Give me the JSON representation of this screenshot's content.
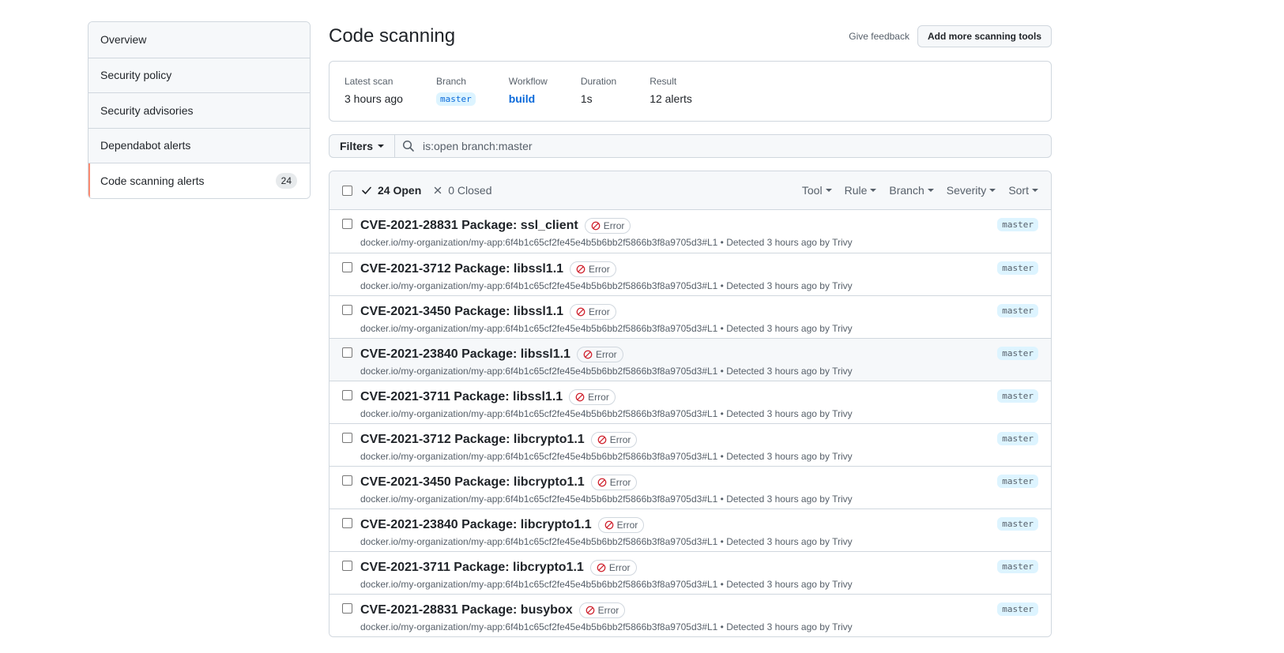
{
  "sidebar": {
    "items": [
      {
        "label": "Overview"
      },
      {
        "label": "Security policy"
      },
      {
        "label": "Security advisories"
      },
      {
        "label": "Dependabot alerts"
      },
      {
        "label": "Code scanning alerts",
        "count": "24",
        "active": true
      }
    ]
  },
  "header": {
    "title": "Code scanning",
    "feedback_label": "Give feedback",
    "add_tools_label": "Add more scanning tools"
  },
  "scan": {
    "latest_label": "Latest scan",
    "latest_value": "3 hours ago",
    "branch_label": "Branch",
    "branch_value": "master",
    "workflow_label": "Workflow",
    "workflow_value": "build",
    "duration_label": "Duration",
    "duration_value": "1s",
    "result_label": "Result",
    "result_value": "12 alerts"
  },
  "filterbar": {
    "filters_label": "Filters",
    "search_value": "is:open branch:master"
  },
  "alerts_header": {
    "open_label": "24 Open",
    "closed_label": "0 Closed",
    "filters": [
      "Tool",
      "Rule",
      "Branch",
      "Severity",
      "Sort"
    ]
  },
  "colors": {
    "accent": "#0969da",
    "active_indicator": "#fd8c73",
    "error": "#cf222e",
    "branch_bg": "#ddf4ff"
  },
  "icons": {
    "search": "search-icon",
    "check": "check-icon",
    "x": "x-icon",
    "error": "circle-slash-icon"
  },
  "alerts": [
    {
      "title": "CVE-2021-28831 Package: ssl_client",
      "severity": "Error",
      "meta": "docker.io/my-organization/my-app:6f4b1c65cf2fe45e4b5b6bb2f5866b3f8a9705d3#L1 • Detected 3 hours ago by Trivy",
      "branch": "master"
    },
    {
      "title": "CVE-2021-3712 Package: libssl1.1",
      "severity": "Error",
      "meta": "docker.io/my-organization/my-app:6f4b1c65cf2fe45e4b5b6bb2f5866b3f8a9705d3#L1 • Detected 3 hours ago by Trivy",
      "branch": "master"
    },
    {
      "title": "CVE-2021-3450 Package: libssl1.1",
      "severity": "Error",
      "meta": "docker.io/my-organization/my-app:6f4b1c65cf2fe45e4b5b6bb2f5866b3f8a9705d3#L1 • Detected 3 hours ago by Trivy",
      "branch": "master"
    },
    {
      "title": "CVE-2021-23840 Package: libssl1.1",
      "severity": "Error",
      "meta": "docker.io/my-organization/my-app:6f4b1c65cf2fe45e4b5b6bb2f5866b3f8a9705d3#L1 • Detected 3 hours ago by Trivy",
      "branch": "master",
      "hover": true
    },
    {
      "title": "CVE-2021-3711 Package: libssl1.1",
      "severity": "Error",
      "meta": "docker.io/my-organization/my-app:6f4b1c65cf2fe45e4b5b6bb2f5866b3f8a9705d3#L1 • Detected 3 hours ago by Trivy",
      "branch": "master"
    },
    {
      "title": "CVE-2021-3712 Package: libcrypto1.1",
      "severity": "Error",
      "meta": "docker.io/my-organization/my-app:6f4b1c65cf2fe45e4b5b6bb2f5866b3f8a9705d3#L1 • Detected 3 hours ago by Trivy",
      "branch": "master"
    },
    {
      "title": "CVE-2021-3450 Package: libcrypto1.1",
      "severity": "Error",
      "meta": "docker.io/my-organization/my-app:6f4b1c65cf2fe45e4b5b6bb2f5866b3f8a9705d3#L1 • Detected 3 hours ago by Trivy",
      "branch": "master"
    },
    {
      "title": "CVE-2021-23840 Package: libcrypto1.1",
      "severity": "Error",
      "meta": "docker.io/my-organization/my-app:6f4b1c65cf2fe45e4b5b6bb2f5866b3f8a9705d3#L1 • Detected 3 hours ago by Trivy",
      "branch": "master"
    },
    {
      "title": "CVE-2021-3711 Package: libcrypto1.1",
      "severity": "Error",
      "meta": "docker.io/my-organization/my-app:6f4b1c65cf2fe45e4b5b6bb2f5866b3f8a9705d3#L1 • Detected 3 hours ago by Trivy",
      "branch": "master"
    },
    {
      "title": "CVE-2021-28831 Package: busybox",
      "severity": "Error",
      "meta": "docker.io/my-organization/my-app:6f4b1c65cf2fe45e4b5b6bb2f5866b3f8a9705d3#L1 • Detected 3 hours ago by Trivy",
      "branch": "master"
    }
  ]
}
